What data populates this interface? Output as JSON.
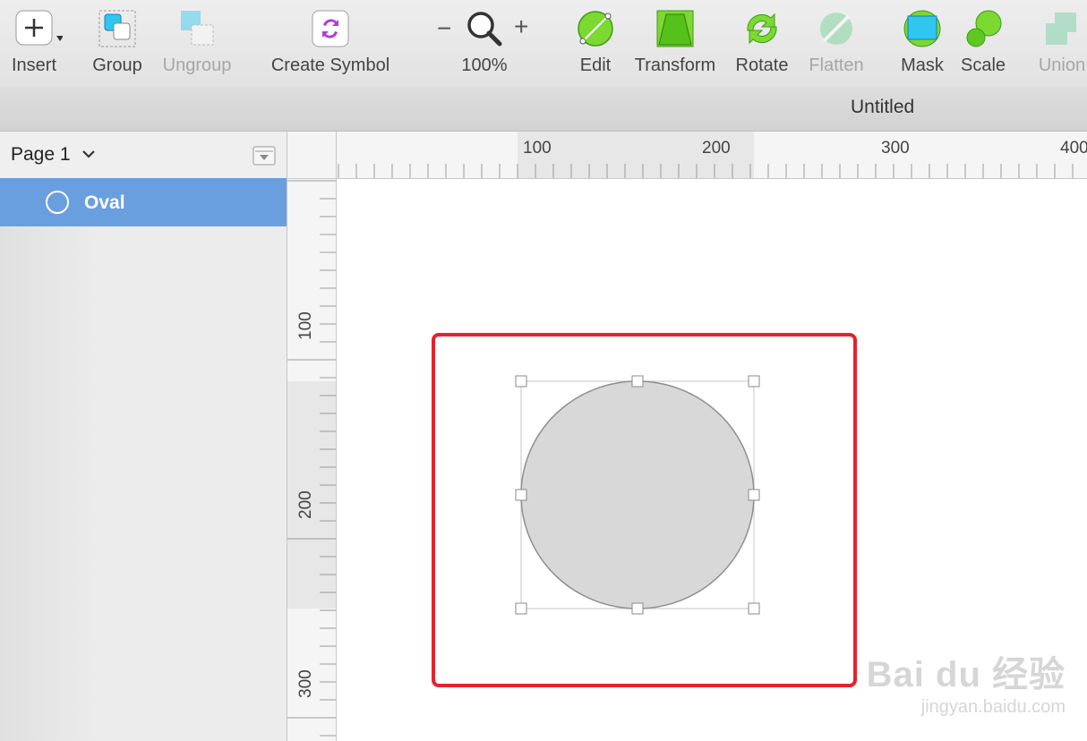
{
  "toolbar": {
    "insert": {
      "label": "Insert",
      "icon": "plus-icon"
    },
    "group": {
      "label": "Group",
      "icon": "group-icon"
    },
    "ungroup": {
      "label": "Ungroup",
      "icon": "ungroup-icon",
      "disabled": true
    },
    "create_symbol": {
      "label": "Create Symbol",
      "icon": "symbol-icon"
    },
    "zoom": {
      "label": "100%",
      "minus": "−",
      "plus": "+",
      "icon": "magnifier-icon"
    },
    "edit": {
      "label": "Edit",
      "icon": "edit-icon"
    },
    "transform": {
      "label": "Transform",
      "icon": "transform-icon"
    },
    "rotate": {
      "label": "Rotate",
      "icon": "rotate-icon"
    },
    "flatten": {
      "label": "Flatten",
      "icon": "flatten-icon",
      "disabled": true
    },
    "mask": {
      "label": "Mask",
      "icon": "mask-icon"
    },
    "scale": {
      "label": "Scale",
      "icon": "scale-icon"
    },
    "union": {
      "label": "Union",
      "icon": "union-icon",
      "disabled": true
    }
  },
  "document": {
    "title": "Untitled"
  },
  "sidebar": {
    "page": "Page 1",
    "layers": [
      {
        "label": "Oval",
        "icon": "oval-icon",
        "selected": true
      }
    ]
  },
  "rulers": {
    "horizontal": [
      "100",
      "200",
      "300",
      "400"
    ],
    "vertical": [
      "100",
      "200",
      "300"
    ]
  },
  "canvas": {
    "shape": "oval",
    "shape_fill": "#d8d8d8",
    "highlight_color": "#e8212b",
    "selection_color": "#6a9fdf"
  },
  "watermark": {
    "main": "Bai du 经验",
    "sub": "jingyan.baidu.com"
  }
}
